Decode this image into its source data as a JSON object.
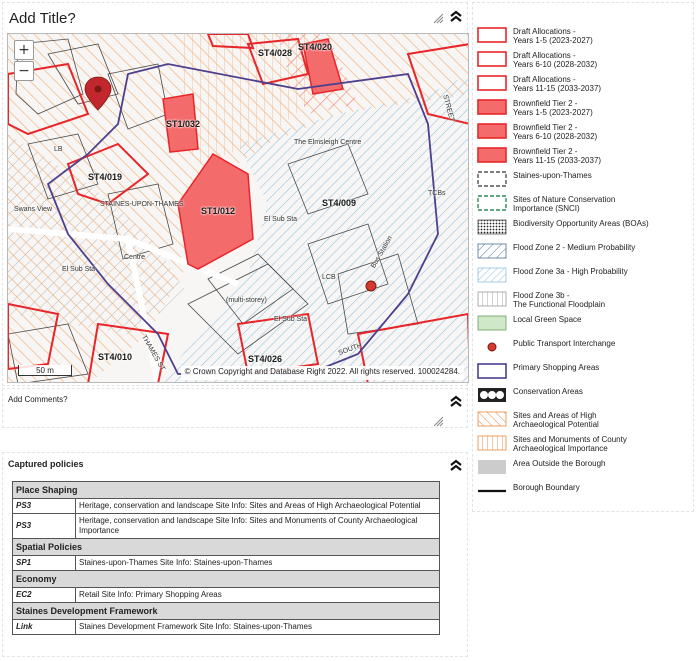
{
  "map_panel": {
    "title_placeholder": "Add Title?",
    "zoom_in": "+",
    "zoom_out": "−",
    "scale_label": "50 m",
    "attribution": "© Crown Copyright and Database Right 2022. All rights reserved. 100024284.",
    "site_labels": [
      "ST4/028",
      "ST4/020",
      "ST1/032",
      "ST4/019",
      "ST1/012",
      "ST4/009",
      "ST4/010",
      "ST4/026"
    ],
    "place_labels": [
      "The Elmsleigh Centre",
      "STAINES-UPON-THAMES",
      "Swans View",
      "El Sub Sta",
      "El Sub Sta",
      "El Sub Sta",
      "Centre",
      "(multi-storey)",
      "Bus Station",
      "TCBs",
      "SOUTH",
      "STREET",
      "THAMES ST",
      "LCB",
      "LB"
    ],
    "colors": {
      "allocation_red": "#e8262a",
      "brownfield_fill": "#f36b6b",
      "shopping_purple": "#4d3f8e",
      "flood_blue": "#7fb5d9",
      "archaeology_orange": "#e8863a"
    }
  },
  "comments_panel": {
    "label": "Add Comments?"
  },
  "policies_panel": {
    "heading": "Captured policies",
    "groups": [
      {
        "name": "Place Shaping",
        "rows": [
          {
            "code": "PS3",
            "text": "Heritage, conservation and landscape Site Info: Sites and Areas of High Archaeological Potential"
          },
          {
            "code": "PS3",
            "text": "Heritage, conservation and landscape Site Info: Sites and Monuments of County Archaeological Importance"
          }
        ]
      },
      {
        "name": "Spatial Policies",
        "rows": [
          {
            "code": "SP1",
            "text": "Staines-upon-Thames Site Info: Staines-upon-Thames"
          }
        ]
      },
      {
        "name": "Economy",
        "rows": [
          {
            "code": "EC2",
            "text": "Retail Site Info: Primary Shopping Areas"
          }
        ]
      },
      {
        "name": "Staines Development Framework",
        "rows": [
          {
            "code": "Link",
            "text": "Staines Development Framework Site Info: Staines-upon-Thames"
          }
        ]
      }
    ]
  },
  "legend": {
    "items": [
      {
        "label": "Draft Allocations -\nYears 1-5 (2023-2027)",
        "swatch": "allocation-outline"
      },
      {
        "label": "Draft Allocations -\nYears 6-10 (2028-2032)",
        "swatch": "allocation-outline"
      },
      {
        "label": "Draft Allocations -\nYears 11-15 (2033-2037)",
        "swatch": "allocation-outline"
      },
      {
        "label": "Brownfield Tier 2 -\nYears 1-5 (2023-2027)",
        "swatch": "brownfield-fill"
      },
      {
        "label": "Brownfield Tier 2 -\nYears 6-10 (2028-2032)",
        "swatch": "brownfield-fill"
      },
      {
        "label": "Brownfield Tier 2 -\nYears 11-15 (2033-2037)",
        "swatch": "brownfield-fill"
      },
      {
        "label": "Staines-upon-Thames",
        "swatch": "dashed-grey"
      },
      {
        "label": "Sites of Nature Conservation\nImportance (SNCI)",
        "swatch": "dashed-green"
      },
      {
        "label": "Biodiversity Opportunity Areas (BOAs)",
        "swatch": "dotted-black"
      },
      {
        "label": "Flood Zone 2 - Medium Probability",
        "swatch": "hatch-blue-dark"
      },
      {
        "label": "Flood Zone 3a - High Probability",
        "swatch": "hatch-blue-light"
      },
      {
        "label": "Flood Zone 3b -\nThe Functional Floodplain",
        "swatch": "vertical-lines"
      },
      {
        "label": "Local Green Space",
        "swatch": "green-fill"
      },
      {
        "label": "Public Transport Interchange",
        "swatch": "red-dot"
      },
      {
        "label": "Primary Shopping Areas",
        "swatch": "purple-outline"
      },
      {
        "label": "Conservation Areas",
        "swatch": "black-scallop"
      },
      {
        "label": "Sites and Areas of High\nArchaeological Potential",
        "swatch": "hatch-orange"
      },
      {
        "label": "Sites and Monuments of County\nArchaeological Importance",
        "swatch": "vertical-orange"
      },
      {
        "label": "Area Outside the Borough",
        "swatch": "grey-fill"
      },
      {
        "label": "Borough Boundary",
        "swatch": "black-line"
      }
    ]
  }
}
